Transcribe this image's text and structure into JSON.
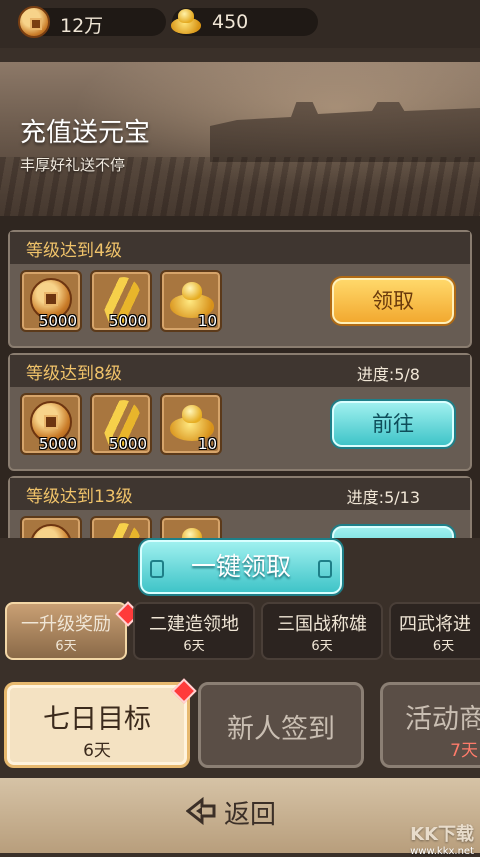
{
  "currencies": {
    "copper": {
      "icon": "copper-coin-icon",
      "value": "12万"
    },
    "gold": {
      "icon": "gold-ingot-icon",
      "value": "450"
    }
  },
  "banner": {
    "title": "充值送元宝",
    "subtitle": "丰厚好礼送不停"
  },
  "rewards": [
    {
      "level": "等级达到4级",
      "progress": "",
      "items": [
        {
          "icon": "copper-coin-icon",
          "qty": "5000"
        },
        {
          "icon": "wheat-icon",
          "qty": "5000"
        },
        {
          "icon": "gold-ingot-icon",
          "qty": "10"
        }
      ],
      "button": "领取"
    },
    {
      "level": "等级达到8级",
      "progress": "进度:5/8",
      "items": [
        {
          "icon": "copper-coin-icon",
          "qty": "5000"
        },
        {
          "icon": "wheat-icon",
          "qty": "5000"
        },
        {
          "icon": "gold-ingot-icon",
          "qty": "10"
        }
      ],
      "button": "前往"
    },
    {
      "level": "等级达到13级",
      "progress": "进度:5/13",
      "items": [
        {
          "icon": "copper-coin-icon",
          "qty": ""
        },
        {
          "icon": "wheat-icon",
          "qty": ""
        },
        {
          "icon": "gold-ingot-icon",
          "qty": ""
        }
      ],
      "button": ""
    }
  ],
  "one_click": "一键领取",
  "sub_tabs": [
    {
      "label": "一升级奖励",
      "days": "6天"
    },
    {
      "label": "二建造领地",
      "days": "6天"
    },
    {
      "label": "三国战称雄",
      "days": "6天"
    },
    {
      "label": "四武将进",
      "days": "6天"
    }
  ],
  "main_tabs": [
    {
      "label": "七日目标",
      "days": "6天"
    },
    {
      "label": "新人签到",
      "days": ""
    },
    {
      "label": "活动商",
      "days": "7天"
    }
  ],
  "back": "返回",
  "watermark": {
    "brand": "KK下载",
    "url": "www.kkx.net"
  },
  "colors": {
    "accent_gold": "#f2a930",
    "accent_teal": "#3fc4c8",
    "badge_red": "#ff3b3b"
  }
}
